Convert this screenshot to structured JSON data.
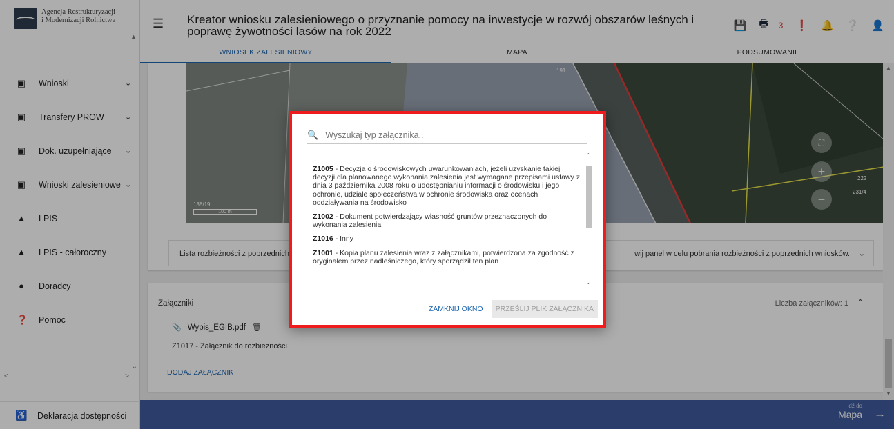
{
  "app": {
    "logo_text_line1": "Agencja Restrukturyzacji",
    "logo_text_line2": "i Modernizacji Rolnictwa",
    "title": "Kreator wniosku zalesieniowego o przyznanie pomocy na inwestycje w rozwój obszarów leśnych i poprawę żywotności lasów na rok 2022",
    "notification_count": "3"
  },
  "sidebar": {
    "items": [
      {
        "label": "Wnioski",
        "icon": "clipboard-icon",
        "chevron": "⌄"
      },
      {
        "label": "Transfery PROW",
        "icon": "clipboard-icon",
        "chevron": "⌄"
      },
      {
        "label": "Dok. uzupełniające",
        "icon": "clipboard-icon",
        "chevron": "⌄"
      },
      {
        "label": "Wnioski zalesieniowe",
        "icon": "clipboard-icon",
        "chevron": "⌄"
      },
      {
        "label": "LPIS",
        "icon": "terrain-icon",
        "chevron": ""
      },
      {
        "label": "LPIS - całoroczny",
        "icon": "terrain-icon",
        "chevron": ""
      },
      {
        "label": "Doradcy",
        "icon": "person-icon",
        "chevron": ""
      },
      {
        "label": "Pomoc",
        "icon": "help-icon",
        "chevron": ""
      }
    ],
    "footer": "Deklaracja dostępności"
  },
  "tabs": [
    {
      "label": "WNIOSEK ZALESIENIOWY",
      "active": true
    },
    {
      "label": "MAPA",
      "active": false
    },
    {
      "label": "PODSUMOWANIE",
      "active": false
    }
  ],
  "map": {
    "scale_label": "100 m",
    "parcel_labels": [
      "188/19",
      "191",
      "222",
      "231/4"
    ]
  },
  "discrepancy": {
    "label": "Lista rozbieżności z poprzednich",
    "hint": "wij panel w celu pobrania rozbieżności z poprzednich wniosków."
  },
  "attachments": {
    "title": "Załączniki",
    "count_label": "Liczba załączników: 1",
    "file_name": "Wypis_EGIB.pdf",
    "file_desc": "Z1017 - Załącznik do rozbieżności",
    "add_label": "DODAJ ZAŁĄCZNIK"
  },
  "bottom_bar": {
    "goto_small": "Idź do",
    "goto_label": "Mapa"
  },
  "dialog": {
    "search_placeholder": "Wyszukaj typ załącznika..",
    "items": [
      {
        "code": "Z1005",
        "text": " - Decyzja o środowiskowych uwarunkowaniach, jeżeli uzyskanie takiej decyzji dla planowanego wykonania zalesienia jest wymagane przepisami ustawy z dnia 3 października 2008 roku o udostępnianiu informacji o środowisku i jego ochronie, udziale społeczeństwa w ochronie środowiska oraz ocenach oddziaływania na środowisko"
      },
      {
        "code": "Z1002",
        "text": " - Dokument potwierdzający własność gruntów przeznaczonych do wykonania zalesienia"
      },
      {
        "code": "Z1016",
        "text": " - Inny"
      },
      {
        "code": "Z1001",
        "text": " - Kopia planu zalesienia wraz z załącznikami, potwierdzona za zgodność z oryginałem przez nadleśniczego, który sporządził ten plan"
      }
    ],
    "close_label": "ZAMKNIJ OKNO",
    "send_label": "PRZEŚLIJ PLIK ZAŁĄCZNIKA"
  },
  "colors": {
    "accent": "#1e66b0",
    "bottom_bar": "#3e5a9e",
    "dialog_border": "#ee1c1c",
    "alert": "#c62828"
  }
}
